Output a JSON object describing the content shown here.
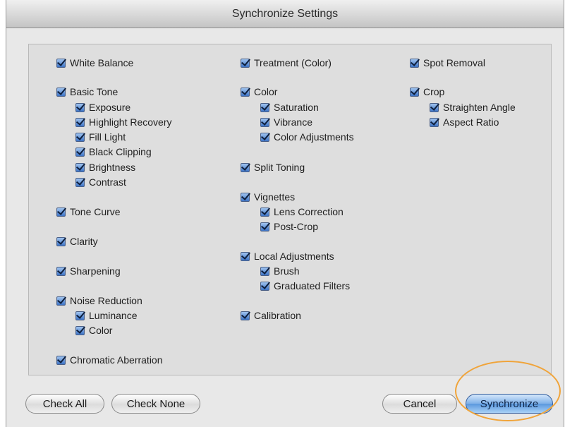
{
  "window": {
    "title": "Synchronize Settings"
  },
  "columns": [
    {
      "items": [
        {
          "label": "White Balance",
          "checked": true
        },
        {
          "label": "Basic Tone",
          "checked": true
        },
        {
          "label": "Exposure",
          "checked": true
        },
        {
          "label": "Highlight Recovery",
          "checked": true
        },
        {
          "label": "Fill Light",
          "checked": true
        },
        {
          "label": "Black Clipping",
          "checked": true
        },
        {
          "label": "Brightness",
          "checked": true
        },
        {
          "label": "Contrast",
          "checked": true
        },
        {
          "label": "Tone Curve",
          "checked": true
        },
        {
          "label": "Clarity",
          "checked": true
        },
        {
          "label": "Sharpening",
          "checked": true
        },
        {
          "label": "Noise Reduction",
          "checked": true
        },
        {
          "label": "Luminance",
          "checked": true
        },
        {
          "label": "Color",
          "checked": true
        },
        {
          "label": "Chromatic Aberration",
          "checked": true
        }
      ]
    },
    {
      "items": [
        {
          "label": "Treatment (Color)",
          "checked": true
        },
        {
          "label": "Color",
          "checked": true
        },
        {
          "label": "Saturation",
          "checked": true
        },
        {
          "label": "Vibrance",
          "checked": true
        },
        {
          "label": "Color Adjustments",
          "checked": true
        },
        {
          "label": "Split Toning",
          "checked": true
        },
        {
          "label": "Vignettes",
          "checked": true
        },
        {
          "label": "Lens Correction",
          "checked": true
        },
        {
          "label": "Post-Crop",
          "checked": true
        },
        {
          "label": "Local Adjustments",
          "checked": true
        },
        {
          "label": "Brush",
          "checked": true
        },
        {
          "label": "Graduated Filters",
          "checked": true
        },
        {
          "label": "Calibration",
          "checked": true
        }
      ]
    },
    {
      "items": [
        {
          "label": "Spot Removal",
          "checked": true
        },
        {
          "label": "Crop",
          "checked": true
        },
        {
          "label": "Straighten Angle",
          "checked": true
        },
        {
          "label": "Aspect Ratio",
          "checked": true
        }
      ]
    }
  ],
  "buttons": {
    "check_all": "Check All",
    "check_none": "Check None",
    "cancel": "Cancel",
    "synchronize": "Synchronize"
  },
  "icons": {
    "checkbox": "checkbox-checked-icon"
  },
  "colors": {
    "highlight_ring": "#f0a43a",
    "checkbox_blue": "#3e74c6"
  }
}
